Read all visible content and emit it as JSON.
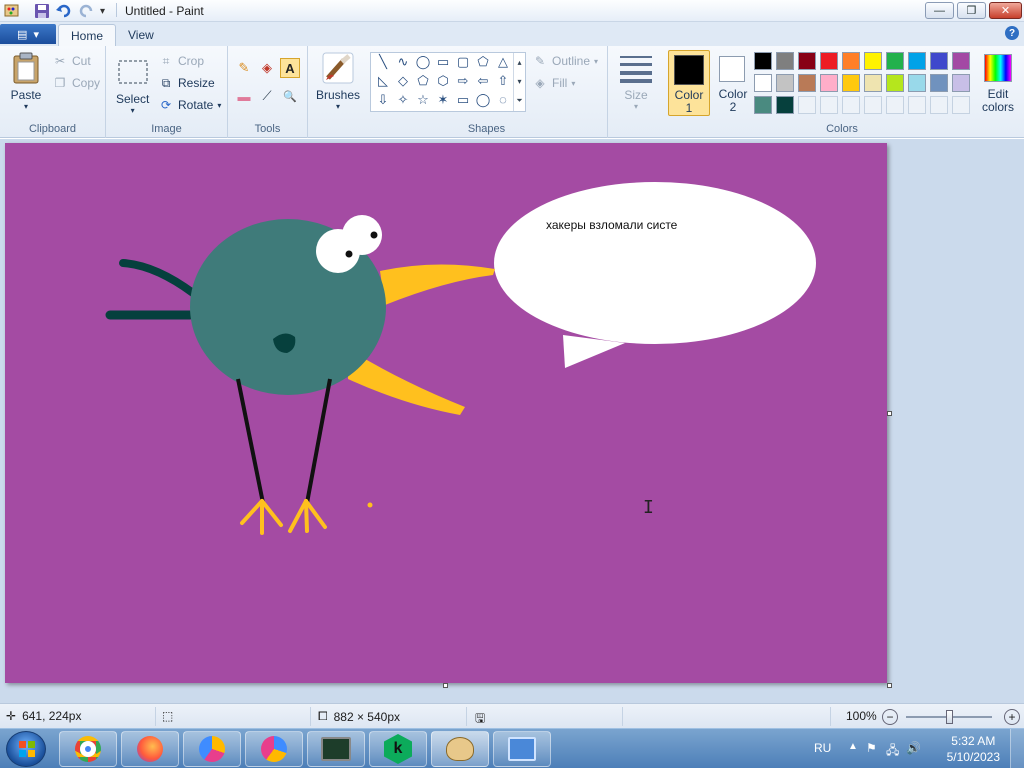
{
  "window": {
    "title": "Untitled - Paint",
    "controls": {
      "minimize": "—",
      "maximize": "❐",
      "close": "✕"
    }
  },
  "ribbon_tabs": {
    "app_menu": "▾",
    "home": "Home",
    "view": "View",
    "help": "?"
  },
  "clipboard": {
    "paste": "Paste",
    "cut": "Cut",
    "copy": "Copy",
    "group": "Clipboard"
  },
  "image": {
    "select": "Select",
    "crop": "Crop",
    "resize": "Resize",
    "rotate": "Rotate",
    "group": "Image"
  },
  "tools": {
    "group": "Tools",
    "items": [
      {
        "name": "pencil-icon",
        "glyph": "✎"
      },
      {
        "name": "fill-icon",
        "glyph": "◈"
      },
      {
        "name": "text-icon",
        "glyph": "A"
      },
      {
        "name": "eraser-icon",
        "glyph": "▬"
      },
      {
        "name": "color-picker-icon",
        "glyph": "⟋"
      },
      {
        "name": "magnifier-icon",
        "glyph": "🔍"
      }
    ]
  },
  "brushes": {
    "label": "Brushes"
  },
  "shapes": {
    "group": "Shapes",
    "outline": "Outline",
    "fill": "Fill",
    "glyphs": [
      "╲",
      "∿",
      "◯",
      "▭",
      "▢",
      "⬠",
      "△",
      "◺",
      "◇",
      "⬠",
      "⬡",
      "⇨",
      "⇦",
      "⇧",
      "⇩",
      "✧",
      "☆",
      "✶",
      "▭",
      "◯",
      "◌"
    ]
  },
  "size": {
    "label": "Size"
  },
  "colors": {
    "group": "Colors",
    "color1": "Color\n1",
    "color1_label_a": "Color",
    "color1_label_b": "1",
    "color2_label_a": "Color",
    "color2_label_b": "2",
    "edit_a": "Edit",
    "edit_b": "colors",
    "color1_value": "#000000",
    "color2_value": "#ffffff",
    "palette_row1": [
      "#000000",
      "#7f7f7f",
      "#880015",
      "#ed1c24",
      "#ff7f27",
      "#fff200",
      "#22b14c",
      "#00a2e8",
      "#3f48cc",
      "#a349a4"
    ],
    "palette_row2": [
      "#ffffff",
      "#c3c3c3",
      "#b97a57",
      "#ffaec9",
      "#ffc90e",
      "#efe4b0",
      "#b5e61d",
      "#99d9ea",
      "#7092be",
      "#c8bfe7"
    ],
    "palette_row3": [
      "#4a8a80",
      "#06403d"
    ]
  },
  "canvas": {
    "background": "#a44ba3",
    "speech_text": "хакеры взломали систе"
  },
  "status": {
    "cursor_pos": "641, 224px",
    "canvas_size": "882 × 540px",
    "zoom": "100%"
  },
  "taskbar": {
    "language": "RU",
    "time": "5:32 AM",
    "date": "5/10/2023"
  }
}
